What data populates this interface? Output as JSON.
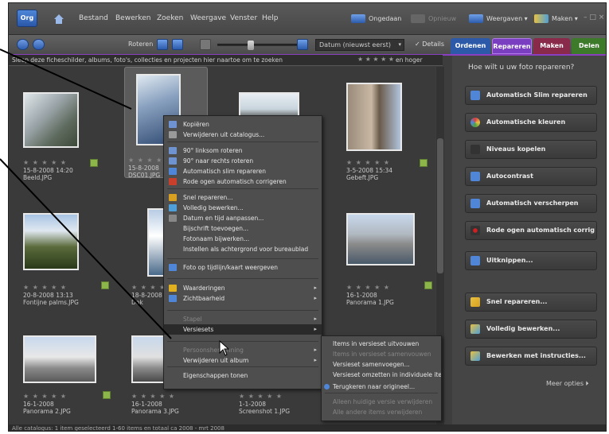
{
  "menubar": {
    "logo": "Org",
    "menus": [
      "Bestand",
      "Bewerken",
      "Zoeken",
      "Weergave",
      "Venster",
      "Help"
    ],
    "ongedaan": "Ongedaan",
    "opnieuw": "Opnieuw",
    "weergaven": "Weergaven",
    "maken": "Maken",
    "window_controls": "– □ ×"
  },
  "toolbar": {
    "roteren": "Roteren",
    "sort": "Datum (nieuwst eerst)",
    "details": "Details"
  },
  "tabs": [
    {
      "label": "Ordenen",
      "color": "#2d5aa8"
    },
    {
      "label": "Repareren",
      "color": "#7a3fc0"
    },
    {
      "label": "Maken",
      "color": "#8a2a4a"
    },
    {
      "label": "Delen",
      "color": "#3d7a2a"
    }
  ],
  "filter_strip": {
    "text": "Sleep deze ficheschilder, albums, foto's, collecties en projecten hier naartoe om te zoeken",
    "stars": "★ ★ ★ ★ ★",
    "suffix": "en hoger"
  },
  "photos": [
    {
      "stars": "★ ★ ★ ★ ★",
      "date": "15-8-2008 14:20",
      "name": "Beeld.JPG"
    },
    {
      "stars": "★ ★ ★ ★ ★",
      "date": "15-8-2008",
      "name": "DSC01.JPG"
    },
    {
      "stars": "",
      "date": "",
      "name": ""
    },
    {
      "stars": "★ ★ ★ ★ ★",
      "date": "3-5-2008 15:34",
      "name": "Gebeft.JPG"
    },
    {
      "stars": "★ ★ ★ ★ ★",
      "date": "20-8-2008 13:13",
      "name": "Fontijne palms.JPG"
    },
    {
      "stars": "★ ★ ★ ★",
      "date": "18-8-2008",
      "name": "Dok"
    },
    {
      "stars": "",
      "date": "",
      "name": ""
    },
    {
      "stars": "★ ★ ★ ★ ★",
      "date": "16-1-2008",
      "name": "Panorama 1.JPG"
    },
    {
      "stars": "★ ★ ★ ★ ★",
      "date": "16-1-2008",
      "name": "Panorama 2.JPG"
    },
    {
      "stars": "★ ★ ★ ★ ★",
      "date": "16-1-2008",
      "name": "Panorama 3.JPG"
    },
    {
      "stars": "★ ★ ★ ★ ★",
      "date": "1-1-2008",
      "name": "Screenshot 1.JPG"
    }
  ],
  "context_menu": {
    "items": [
      {
        "label": "Kopiëren",
        "icon_color": "#6f93d0",
        "disabled": false
      },
      {
        "label": "Verwijderen uit catalogus...",
        "icon_color": "#9a9a9a",
        "disabled": false
      },
      {
        "label": "90° linksom roteren",
        "icon_color": "#6f93d0",
        "disabled": false
      },
      {
        "label": "90° naar rechts roteren",
        "icon_color": "#6f93d0",
        "disabled": false
      },
      {
        "label": "Automatisch slim repareren",
        "icon_color": "#4f86d8",
        "disabled": false
      },
      {
        "label": "Rode ogen automatisch corrigeren",
        "icon_color": "#c8402c",
        "disabled": false
      },
      {
        "label": "Snel repareren...",
        "icon_color": "#d8a020",
        "disabled": false
      },
      {
        "label": "Volledig bewerken...",
        "icon_color": "#4fa0d8",
        "disabled": false
      },
      {
        "label": "Datum en tijd aanpassen...",
        "icon_color": "#888888",
        "disabled": false
      },
      {
        "label": "Bijschrift toevoegen...",
        "icon_color": "",
        "disabled": false
      },
      {
        "label": "Fotonaam bijwerken...",
        "icon_color": "",
        "disabled": false
      },
      {
        "label": "Instellen als achtergrond voor bureaublad",
        "icon_color": "",
        "disabled": false
      },
      {
        "label": "Foto op tijdlijn/kaart weergeven",
        "icon_color": "#4f86d8",
        "disabled": false
      },
      {
        "label": "Waarderingen",
        "icon_color": "#e0b020",
        "disabled": false,
        "submenu": true
      },
      {
        "label": "Zichtbaarheid",
        "icon_color": "#4f86d8",
        "disabled": false,
        "submenu": true
      },
      {
        "label": "Stapel",
        "icon_color": "",
        "disabled": true,
        "submenu": true
      },
      {
        "label": "Versiesets",
        "icon_color": "",
        "disabled": false,
        "submenu": true,
        "highlighted": true
      },
      {
        "label": "Persoonsherkenning",
        "icon_color": "",
        "disabled": true,
        "submenu": true
      },
      {
        "label": "Verwijderen uit album",
        "icon_color": "",
        "disabled": false,
        "submenu": true
      },
      {
        "label": "Eigenschappen tonen",
        "icon_color": "",
        "disabled": false
      }
    ]
  },
  "submenu": {
    "items": [
      {
        "label": "Items in versieset uitvouwen",
        "disabled": false,
        "check": false
      },
      {
        "label": "Items in versieset samenvouwen",
        "disabled": true,
        "check": false
      },
      {
        "label": "Versieset samenvoegen...",
        "disabled": false,
        "check": false
      },
      {
        "label": "Versieset omzetten in individuele items",
        "disabled": false,
        "check": false
      },
      {
        "label": "Terugkeren naar origineel...",
        "disabled": false,
        "check": true
      },
      {
        "label": "Alleen huidige versie verwijderen",
        "disabled": true,
        "check": false
      },
      {
        "label": "Alle andere items verwijderen",
        "disabled": true,
        "check": false
      }
    ]
  },
  "fix_panel": {
    "heading": "Hoe wilt u uw foto repareren?",
    "buttons": [
      {
        "label": "Automatisch Slim repareren",
        "icon_color": "#4f86d8"
      },
      {
        "label": "Automatische kleuren",
        "icon_color": "#d84040"
      },
      {
        "label": "Niveaus kopelen",
        "icon_color": "#444444"
      },
      {
        "label": "Autocontrast",
        "icon_color": "#4f86d8"
      },
      {
        "label": "Automatisch verscherpen",
        "icon_color": "#4f86d8"
      },
      {
        "label": "Rode ogen automatisch corrig",
        "icon_color": "#a02020"
      },
      {
        "label": "Uitknippen...",
        "icon_color": "#4f86d8"
      },
      {
        "label": "Snel repareren...",
        "icon_color": "#d8a020"
      },
      {
        "label": "Volledig bewerken...",
        "icon_color": "#4fa0d8"
      },
      {
        "label": "Bewerken met instructies...",
        "icon_color": "#4fa0d8"
      }
    ],
    "more": "Meer opties ⏵"
  },
  "status": "Alle catalogus: 1 item geselecteerd 1-60 items en totaal ca 2008 - mrt 2008"
}
